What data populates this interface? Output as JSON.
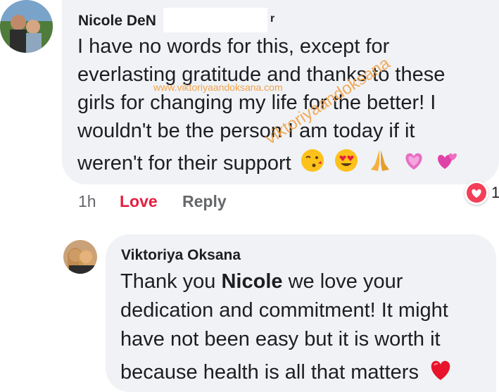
{
  "comment": {
    "author_visible": "Nicole DeN",
    "author_suffix": "r",
    "lines": [
      "I have no words for this, except for",
      "everlasting gratitude and thanks to these",
      "girls for changing my life for the better! I",
      "wouldn't be the person I am today if it",
      "weren't for their support"
    ],
    "time": "1h",
    "love_label": "Love",
    "reply_label": "Reply",
    "reaction_count": "1"
  },
  "reply": {
    "author": "Viktoriya Oksana",
    "line1_pre": "Thank you ",
    "line1_name": "Nicole",
    "line1_post": " we love your",
    "lines": [
      "dedication and commitment! It might",
      "have not been easy but it is worth it",
      "because health is all that matters"
    ]
  },
  "watermark": {
    "url": "www.viktoriyaandoksana.com",
    "text": "viktoriyaandoksana"
  },
  "colors": {
    "bubble": "#f0f2f5",
    "love": "#e41e3f",
    "meta": "#65676b",
    "watermark": "#f3a34a"
  }
}
